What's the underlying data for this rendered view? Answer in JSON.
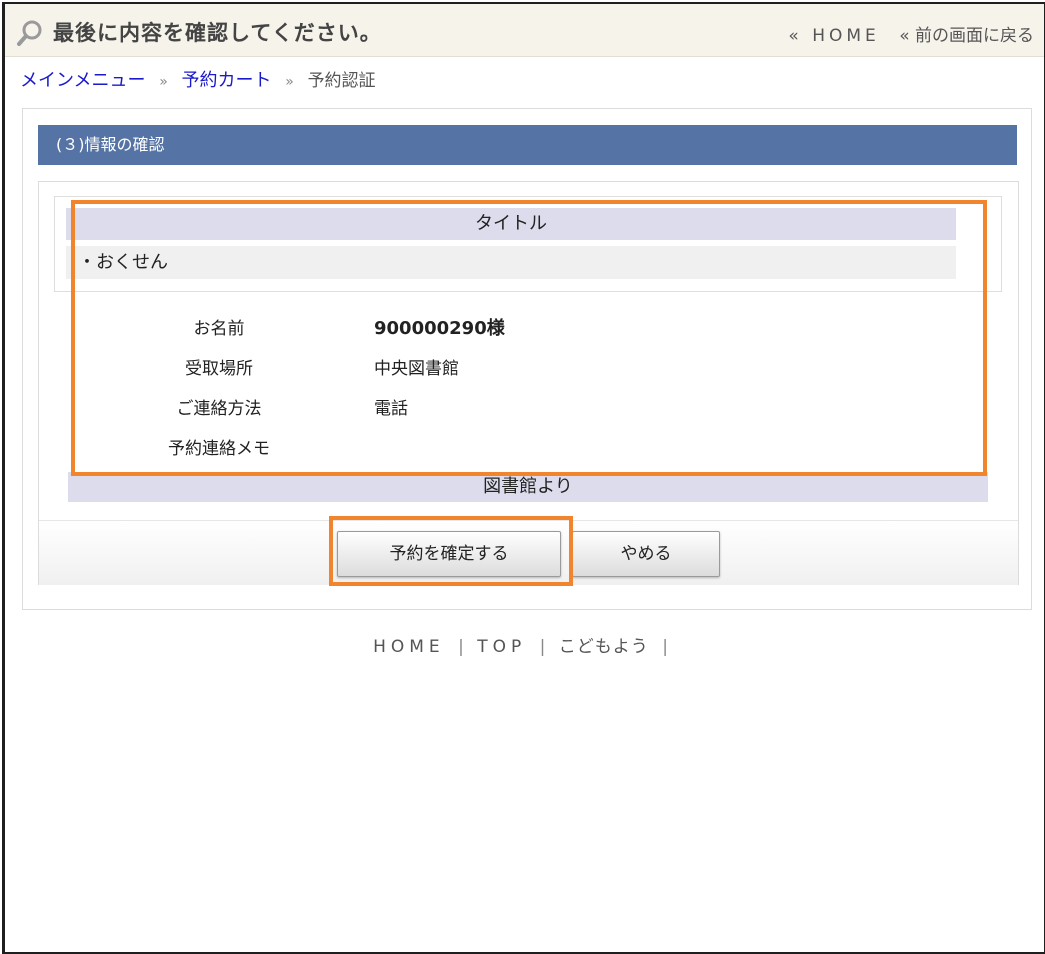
{
  "header": {
    "title": "最後に内容を確認してください。",
    "links": [
      {
        "label": "« HOME"
      },
      {
        "label": "« 前の画面に戻る"
      }
    ]
  },
  "breadcrumb": {
    "items": [
      {
        "label": "メインメニュー"
      },
      {
        "label": "予約カート"
      }
    ],
    "separator": "»",
    "current": "予約認証"
  },
  "section": {
    "title": "(３)情報の確認"
  },
  "title_block": {
    "header": "タイトル",
    "items": [
      "・おくせん"
    ]
  },
  "info": [
    {
      "label": "お名前",
      "value": "900000290様"
    },
    {
      "label": "受取場所",
      "value": "中央図書館"
    },
    {
      "label": "ご連絡方法",
      "value": "電話"
    },
    {
      "label": "予約連絡メモ",
      "value": ""
    }
  ],
  "library_note": {
    "header": "図書館より"
  },
  "buttons": {
    "confirm": "予約を確定する",
    "cancel": "やめる"
  },
  "footer": {
    "links": [
      "HOME",
      "TOP",
      "こどもよう"
    ],
    "separator": "|"
  },
  "colors": {
    "section_header_bg": "#5574a5",
    "highlight": "#f0852d",
    "breadcrumb_link": "#1a1acb",
    "subheader_bg": "#dcdcec"
  }
}
